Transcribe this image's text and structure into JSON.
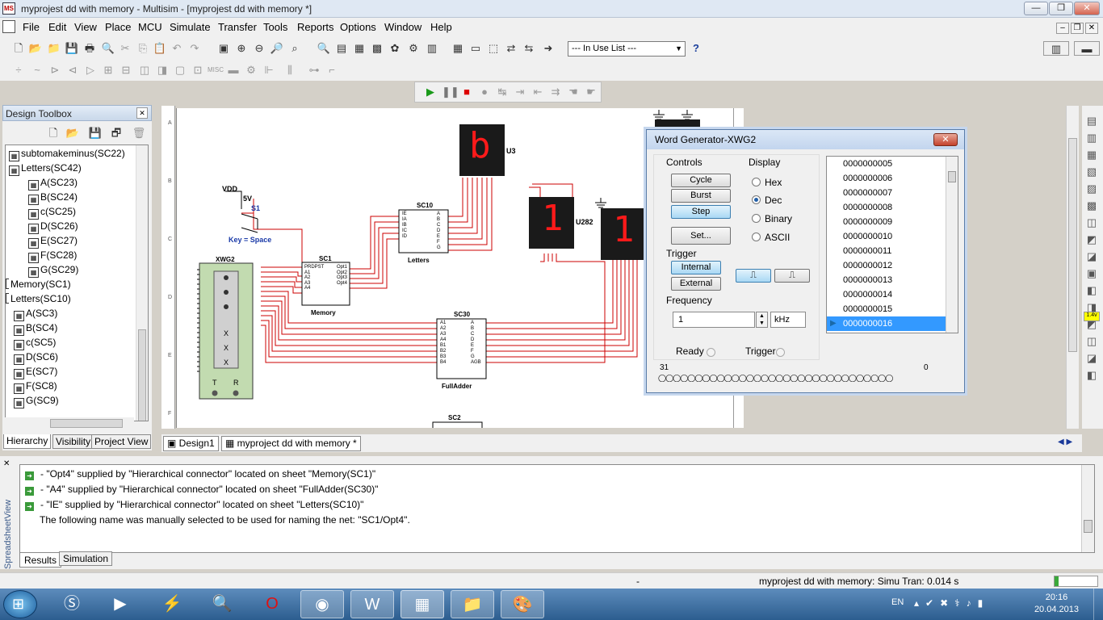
{
  "window": {
    "title": "myprojest dd with memory - Multisim - [myprojest dd with memory *]",
    "min": "—",
    "restore": "❐",
    "close": "✕",
    "app_icon": "MS"
  },
  "menu": [
    "File",
    "Edit",
    "View",
    "Place",
    "MCU",
    "Simulate",
    "Transfer",
    "Tools",
    "Reports",
    "Options",
    "Window",
    "Help"
  ],
  "mdi": [
    "–",
    "❐",
    "✕"
  ],
  "toolbar": {
    "in_use_list": "--- In Use List ---"
  },
  "toolbox": {
    "title": "Design Toolbox",
    "close": "✕",
    "tree": [
      {
        "label": "subtomakeminus(SC22)",
        "indent": 1
      },
      {
        "label": "Letters(SC42)",
        "indent": 1
      },
      {
        "label": "A(SC23)",
        "indent": 2
      },
      {
        "label": "B(SC24)",
        "indent": 2
      },
      {
        "label": "c(SC25)",
        "indent": 2
      },
      {
        "label": "D(SC26)",
        "indent": 2
      },
      {
        "label": "E(SC27)",
        "indent": 2
      },
      {
        "label": "F(SC28)",
        "indent": 2
      },
      {
        "label": "G(SC29)",
        "indent": 2
      },
      {
        "label": "Memory(SC1)",
        "indent": 0
      },
      {
        "label": "Letters(SC10)",
        "indent": 0
      },
      {
        "label": "A(SC3)",
        "indent": 1
      },
      {
        "label": "B(SC4)",
        "indent": 1
      },
      {
        "label": "c(SC5)",
        "indent": 1
      },
      {
        "label": "D(SC6)",
        "indent": 1
      },
      {
        "label": "E(SC7)",
        "indent": 1
      },
      {
        "label": "F(SC8)",
        "indent": 1
      },
      {
        "label": "G(SC9)",
        "indent": 1
      }
    ],
    "tabs": [
      "Hierarchy",
      "Visibility",
      "Project View"
    ]
  },
  "schematic": {
    "rows": [
      "A",
      "B",
      "C",
      "D",
      "E",
      "F"
    ],
    "vdd": "VDD",
    "v5": "5V",
    "s1": "S1",
    "key": "Key = Space",
    "xwg2": "XWG2",
    "sc1": "SC1",
    "sc1_name": "Memory",
    "sc10": "SC10",
    "sc10_name": "Letters",
    "sc30": "SC30",
    "sc30_name": "FullAdder",
    "sc2": "SC2",
    "u3": "U3",
    "u282": "U282",
    "seg1": "b",
    "seg2": "1",
    "seg3": "1",
    "xwg_t": "T",
    "xwg_r": "R",
    "sc1_in": [
      "PRDPST",
      "A1",
      "A2",
      "A3",
      "A4"
    ],
    "sc1_out": [
      "Opt1",
      "Opt2",
      "Opt3",
      "Opt4"
    ],
    "sc10_in": [
      "IE",
      "IA",
      "IB",
      "IC",
      "ID"
    ],
    "sc10_out": [
      "A",
      "B",
      "C",
      "D",
      "E",
      "F",
      "G"
    ],
    "sc30_in": [
      "A1",
      "A2",
      "A3",
      "A4",
      "B1",
      "B2",
      "B3",
      "B4"
    ],
    "sc30_out": [
      "A",
      "B",
      "C",
      "D",
      "E",
      "F",
      "G",
      "AGB"
    ]
  },
  "doc_tabs": [
    "Design1",
    "myproject dd with memory *"
  ],
  "word_gen": {
    "title": "Word Generator-XWG2",
    "controls_label": "Controls",
    "buttons": [
      "Cycle",
      "Burst",
      "Step",
      "Set..."
    ],
    "display_label": "Display",
    "display_options": [
      "Hex",
      "Dec",
      "Binary",
      "ASCII"
    ],
    "display_selected": "Dec",
    "trigger_label": "Trigger",
    "trigger_buttons": [
      "Internal",
      "External"
    ],
    "frequency_label": "Frequency",
    "frequency_value": "1",
    "frequency_unit": "kHz",
    "ready_label": "Ready",
    "trigger_status_label": "Trigger",
    "bit_high": "31",
    "bit_low": "0",
    "words": [
      "0000000005",
      "0000000006",
      "0000000007",
      "0000000008",
      "0000000009",
      "0000000010",
      "0000000011",
      "0000000012",
      "0000000013",
      "0000000014",
      "0000000015",
      "0000000016"
    ],
    "selected_word": "0000000016"
  },
  "results": {
    "lines": [
      "- \"Opt4\" supplied by \"Hierarchical connector\" located on sheet \"Memory(SC1)\"",
      "- \"A4\" supplied by \"Hierarchical connector\" located on sheet \"FullAdder(SC30)\"",
      "- \"IE\" supplied by \"Hierarchical connector\" located on sheet \"Letters(SC10)\""
    ],
    "note": "The following name was manually selected to be used for naming the net: \"SC1/Opt4\".",
    "side_label": "SpreadsheetView",
    "tabs": [
      "Results",
      "Simulation"
    ]
  },
  "status": {
    "dash": "-",
    "sim": "myprojest dd with memory: Simu  Tran: 0.014 s"
  },
  "taskbar": {
    "lang": "EN",
    "time": "20:16",
    "date": "20.04.2013"
  }
}
